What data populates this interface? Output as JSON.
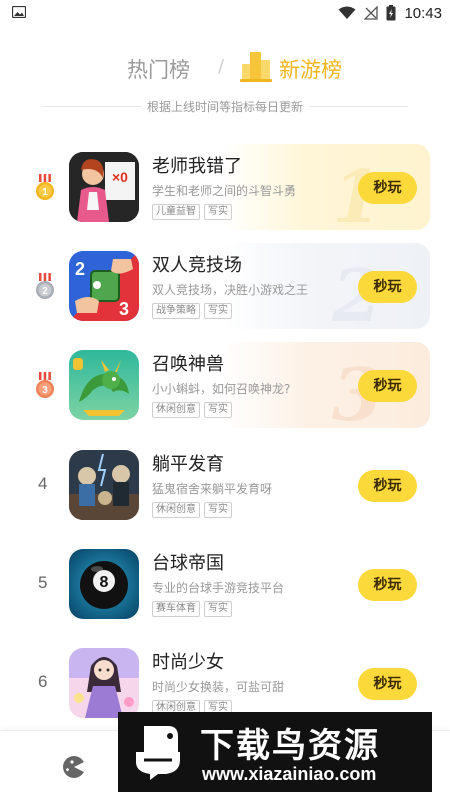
{
  "status_bar": {
    "time": "10:43"
  },
  "tabs": {
    "hot": "热门榜",
    "separator": "/",
    "new": "新游榜"
  },
  "subtitle": "根据上线时间等指标每日更新",
  "games": [
    {
      "rank": "1",
      "name": "老师我错了",
      "desc": "学生和老师之间的斗智斗勇",
      "tags": [
        "儿童益智",
        "写实"
      ],
      "play_label": "秒玩"
    },
    {
      "rank": "2",
      "name": "双人竞技场",
      "desc": "双人竞技场，决胜小游戏之王",
      "tags": [
        "战争策略",
        "写实"
      ],
      "play_label": "秒玩"
    },
    {
      "rank": "3",
      "name": "召唤神兽",
      "desc": "小小蝌蚪，如何召唤神龙?",
      "tags": [
        "休闲创意",
        "写实"
      ],
      "play_label": "秒玩"
    },
    {
      "rank": "4",
      "name": "躺平发育",
      "desc": "猛鬼宿舍来躺平发育呀",
      "tags": [
        "休闲创意",
        "写实"
      ],
      "play_label": "秒玩"
    },
    {
      "rank": "5",
      "name": "台球帝国",
      "desc": "专业的台球手游竞技平台",
      "tags": [
        "赛车体育",
        "写实"
      ],
      "play_label": "秒玩"
    },
    {
      "rank": "6",
      "name": "时尚少女",
      "desc": "时尚少女换装，可盐可甜",
      "tags": [
        "休闲创意",
        "写实"
      ],
      "play_label": "秒玩"
    }
  ],
  "watermark": {
    "title": "下载鸟资源",
    "url": "www.xiazainiao.com"
  },
  "colors": {
    "accent": "#fcd93a",
    "gold": "#f2b61f",
    "silver": "#b9bcc4",
    "bronze": "#f0936a"
  }
}
